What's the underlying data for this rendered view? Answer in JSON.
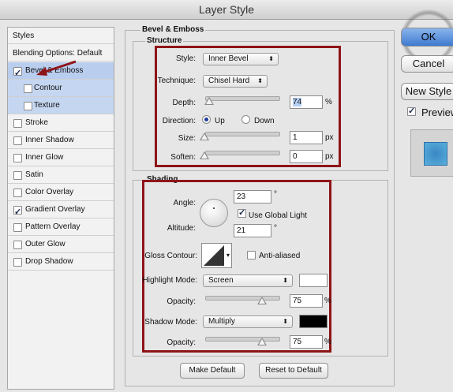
{
  "window": {
    "title": "Layer Style"
  },
  "styles_list": {
    "header": "Styles",
    "blending": "Blending Options: Default",
    "items": [
      {
        "label": "Bevel & Emboss",
        "checked": true,
        "selected": true
      },
      {
        "label": "Contour",
        "checked": false,
        "sub": true
      },
      {
        "label": "Texture",
        "checked": false,
        "sub": true
      },
      {
        "label": "Stroke",
        "checked": false
      },
      {
        "label": "Inner Shadow",
        "checked": false
      },
      {
        "label": "Inner Glow",
        "checked": false
      },
      {
        "label": "Satin",
        "checked": false
      },
      {
        "label": "Color Overlay",
        "checked": false
      },
      {
        "label": "Gradient Overlay",
        "checked": true
      },
      {
        "label": "Pattern Overlay",
        "checked": false
      },
      {
        "label": "Outer Glow",
        "checked": false
      },
      {
        "label": "Drop Shadow",
        "checked": false
      }
    ]
  },
  "bevel": {
    "title": "Bevel & Emboss",
    "structure": {
      "title": "Structure",
      "style_label": "Style:",
      "style_value": "Inner Bevel",
      "technique_label": "Technique:",
      "technique_value": "Chisel Hard",
      "depth_label": "Depth:",
      "depth_value": "74",
      "depth_unit": "%",
      "direction_label": "Direction:",
      "dir_up": "Up",
      "dir_down": "Down",
      "size_label": "Size:",
      "size_value": "1",
      "size_unit": "px",
      "soften_label": "Soften:",
      "soften_value": "0",
      "soften_unit": "px"
    },
    "shading": {
      "title": "Shading",
      "angle_label": "Angle:",
      "angle_value": "23",
      "degree": "°",
      "global_light": "Use Global Light",
      "altitude_label": "Altitude:",
      "altitude_value": "21",
      "gloss_label": "Gloss Contour:",
      "anti_aliased": "Anti-aliased",
      "highlight_label": "Highlight Mode:",
      "highlight_value": "Screen",
      "opacity_label": "Opacity:",
      "highlight_opacity": "75",
      "pct": "%",
      "shadow_label": "Shadow Mode:",
      "shadow_value": "Multiply",
      "shadow_opacity": "75"
    },
    "make_default": "Make Default",
    "reset_default": "Reset to Default"
  },
  "buttons": {
    "ok": "OK",
    "cancel": "Cancel",
    "new_style": "New Style",
    "preview": "Preview"
  },
  "colors": {
    "highlight_swatch": "#ffffff",
    "shadow_swatch": "#000000",
    "annotation": "#8e1418",
    "ok_button": "#5b8fd6"
  }
}
